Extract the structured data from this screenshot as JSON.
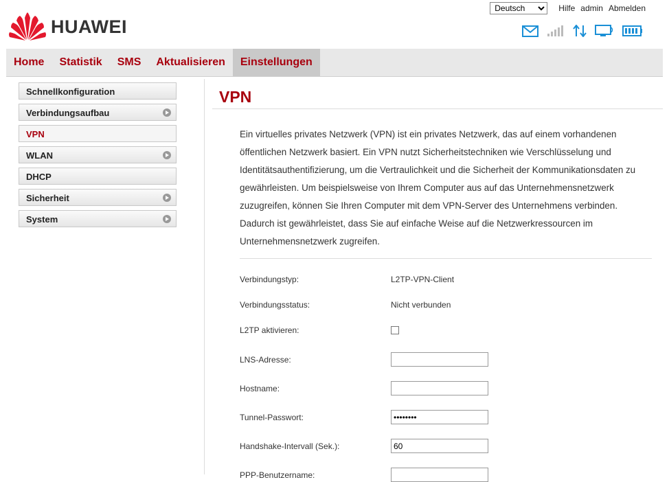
{
  "header": {
    "brand": "HUAWEI",
    "language": "Deutsch",
    "help_label": "Hilfe",
    "user": "admin",
    "logout_label": "Abmelden"
  },
  "nav": [
    "Home",
    "Statistik",
    "SMS",
    "Aktualisieren",
    "Einstellungen"
  ],
  "sidebar": [
    {
      "label": "Schnellkonfiguration"
    },
    {
      "label": "Verbindungsaufbau"
    },
    {
      "label": "VPN"
    },
    {
      "label": "WLAN"
    },
    {
      "label": "DHCP"
    },
    {
      "label": "Sicherheit"
    },
    {
      "label": "System"
    }
  ],
  "main": {
    "title": "VPN",
    "description": "Ein virtuelles privates Netzwerk (VPN) ist ein privates Netzwerk, das auf einem vorhandenen öffentlichen Netzwerk basiert. Ein VPN nutzt Sicherheitstechniken wie Verschlüsselung und Identitätsauthentifizierung, um die Vertraulichkeit und die Sicherheit der Kommunikationsdaten zu gewährleisten. Um beispielsweise von Ihrem Computer aus auf das Unternehmensnetzwerk zuzugreifen, können Sie Ihren Computer mit dem VPN-Server des Unternehmens verbinden. Dadurch ist gewährleistet, dass Sie auf einfache Weise auf die Netzwerkressourcen im Unternehmensnetzwerk zugreifen.",
    "fields": {
      "type_label": "Verbindungstyp:",
      "type_value": "L2TP-VPN-Client",
      "status_label": "Verbindungsstatus:",
      "status_value": "Nicht verbunden",
      "l2tp_label": "L2TP aktivieren:",
      "lns_label": "LNS-Adresse:",
      "lns_value": "",
      "hostname_label": "Hostname:",
      "hostname_value": "",
      "tunnel_pw_label": "Tunnel-Passwort:",
      "tunnel_pw_value": "••••••••",
      "handshake_label": "Handshake-Intervall (Sek.):",
      "handshake_value": "60",
      "ppp_user_label": "PPP-Benutzername:"
    }
  },
  "colors": {
    "accent": "#a8000e",
    "logo_red": "#e3182d",
    "icon_blue": "#1a8fd6"
  },
  "icons": [
    "mail-icon",
    "signal-icon",
    "data-transfer-icon",
    "connection-monitor-icon",
    "battery-icon",
    "arrow-right-icon"
  ]
}
